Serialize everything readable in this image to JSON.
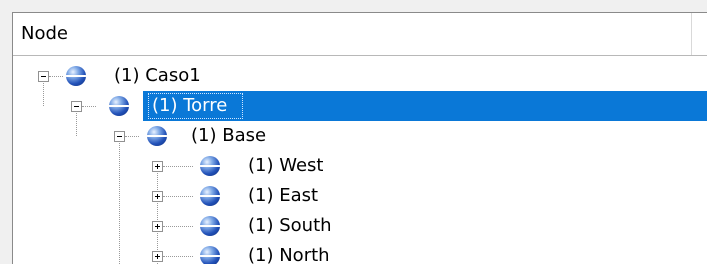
{
  "header": {
    "column_label": "Node"
  },
  "tree": {
    "nodes": [
      {
        "label": "(1) Caso1",
        "depth": 0,
        "expander": "minus",
        "selected": false
      },
      {
        "label": "(1) Torre",
        "depth": 1,
        "expander": "minus",
        "selected": true
      },
      {
        "label": "(1) Base",
        "depth": 2,
        "expander": "minus",
        "selected": false
      },
      {
        "label": "(1) West",
        "depth": 3,
        "expander": "plus",
        "selected": false
      },
      {
        "label": "(1) East",
        "depth": 3,
        "expander": "plus",
        "selected": false
      },
      {
        "label": "(1) South",
        "depth": 3,
        "expander": "plus",
        "selected": false
      },
      {
        "label": "(1) North",
        "depth": 3,
        "expander": "plus",
        "selected": false
      }
    ]
  },
  "colors": {
    "selection": "#0a78d7",
    "node_icon": "#2251b8",
    "background": "#f0f0f0"
  }
}
